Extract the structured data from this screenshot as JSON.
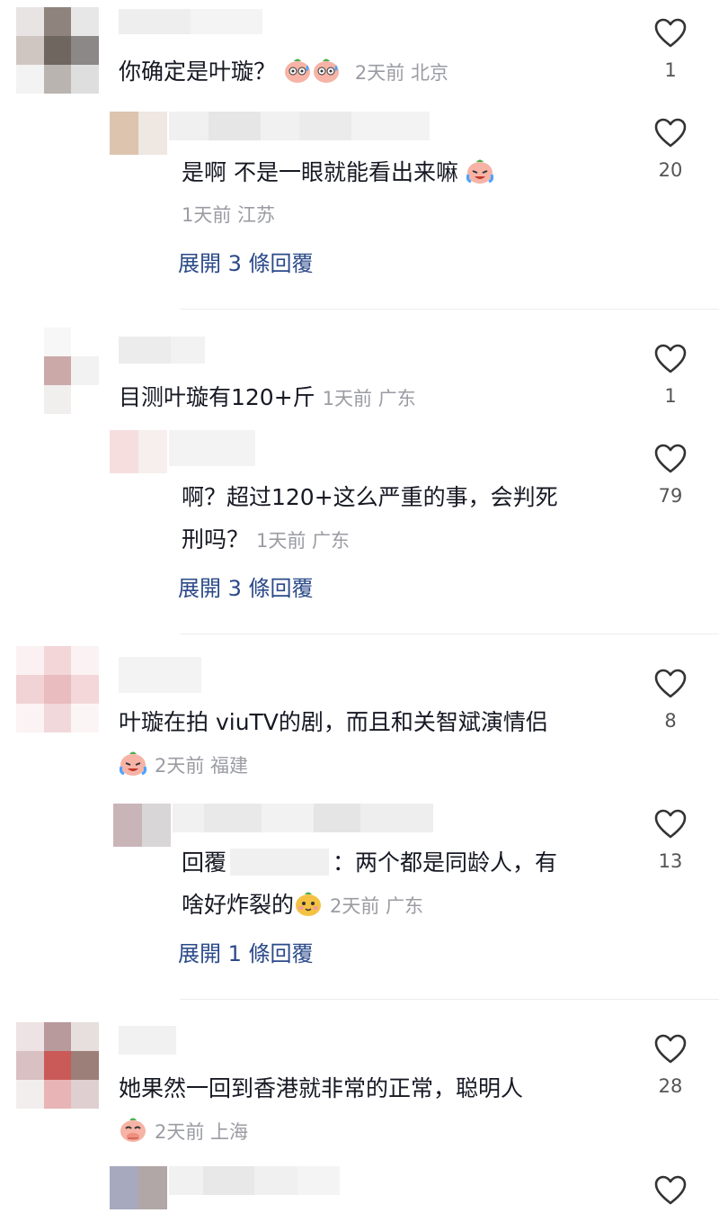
{
  "comments": [
    {
      "text": "你确定是叶璇？",
      "emoji": [
        "sweat-emoji-icon",
        "sweat-emoji-icon"
      ],
      "meta": "2天前 北京",
      "likes": "1",
      "reply": {
        "text": "是啊 不是一眼就能看出来嘛",
        "emoji": [
          "laugh-cry-emoji-icon"
        ],
        "meta": "1天前 江苏",
        "likes": "20",
        "expand": "展開 3 條回覆"
      }
    },
    {
      "text": "目测叶璇有120+斤",
      "meta": "1天前 广东",
      "likes": "1",
      "reply": {
        "text_line1": "啊？超过120+这么严重的事，会判死",
        "text_line2": "刑吗？",
        "meta": "1天前 广东",
        "likes": "79",
        "expand": "展開 3 條回覆"
      }
    },
    {
      "text_line1": "叶璇在拍 viuTV的剧，而且和关智斌演情侣",
      "emoji": [
        "laugh-cry-emoji-icon"
      ],
      "meta": "2天前 福建",
      "likes": "8",
      "reply": {
        "prefix": "回覆",
        "text_line1": "：两个都是同龄人，有",
        "text_line2": "啥好炸裂的",
        "emoji": [
          "shy-emoji-icon"
        ],
        "meta": "2天前 广东",
        "likes": "13",
        "expand": "展開 1 條回覆"
      }
    },
    {
      "text_line1": "她果然一回到香港就非常的正常，聪明人",
      "emoji": [
        "cover-mouth-emoji-icon"
      ],
      "meta": "2天前 上海",
      "likes": "28"
    }
  ]
}
